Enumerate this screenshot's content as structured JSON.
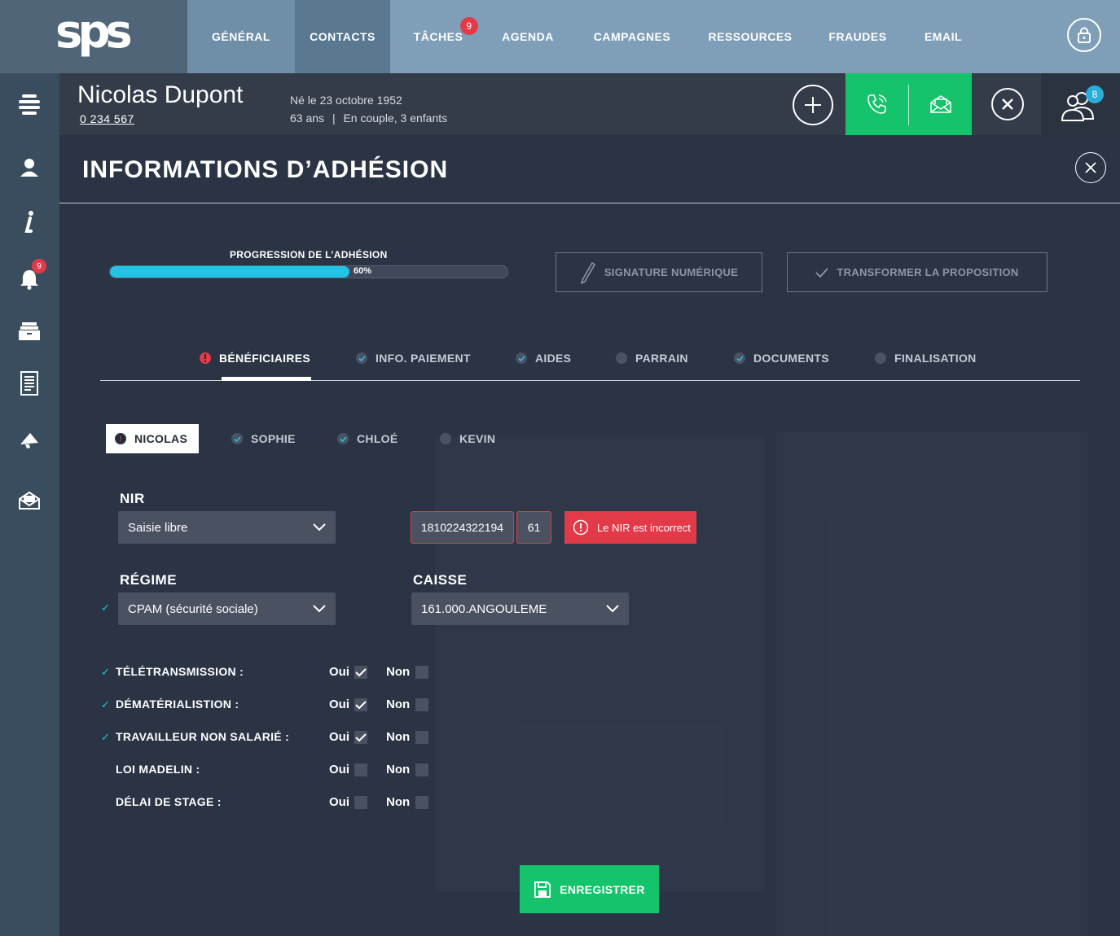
{
  "app": {
    "logo_text": "sps",
    "nav": [
      {
        "label": "GÉNÉRAL"
      },
      {
        "label": "CONTACTS"
      },
      {
        "label": "TÂCHES",
        "badge": "9"
      },
      {
        "label": "AGENDA"
      },
      {
        "label": "CAMPAGNES"
      },
      {
        "label": "RESSOURCES"
      },
      {
        "label": "FRAUDES"
      },
      {
        "label": "EMAIL"
      }
    ],
    "sidebar": {
      "notifications_badge": "9"
    }
  },
  "contact": {
    "name": "Nicolas Dupont",
    "id": "0 234 567",
    "birth": "Né le 23 octobre 1952",
    "age": "63 ans",
    "family": "En couple, 3 enfants",
    "users_badge": "8"
  },
  "modal": {
    "title": "INFORMATIONS D’ADHÉSION",
    "progress": {
      "label": "PROGRESSION DE L’ADHÉSION",
      "percent": 60,
      "percent_text": "60%"
    },
    "actions": {
      "signature": "SIGNATURE NUMÉRIQUE",
      "transform": "TRANSFORMER LA PROPOSITION"
    },
    "tabs": [
      {
        "label": "BÉNÉFICIAIRES",
        "status": "error",
        "active": true
      },
      {
        "label": "INFO. PAIEMENT",
        "status": "check"
      },
      {
        "label": "AIDES",
        "status": "check"
      },
      {
        "label": "PARRAIN",
        "status": "empty"
      },
      {
        "label": "DOCUMENTS",
        "status": "check"
      },
      {
        "label": "FINALISATION",
        "status": "empty"
      }
    ],
    "persons": [
      {
        "label": "NICOLAS",
        "status": "error",
        "active": true
      },
      {
        "label": "SOPHIE",
        "status": "check"
      },
      {
        "label": "CHLOÉ",
        "status": "check"
      },
      {
        "label": "KEVIN",
        "status": "empty"
      }
    ],
    "form": {
      "nir_label": "NIR",
      "nir_mode": "Saisie libre",
      "nir_value": "1810224322194",
      "nir_key": "61",
      "nir_error": "Le NIR est incorrect",
      "regime_label": "RÉGIME",
      "regime_value": "CPAM (sécurité sociale)",
      "caisse_label": "CAISSE",
      "caisse_value": "161.000.ANGOULEME",
      "yes": "Oui",
      "no": "Non",
      "options": [
        {
          "label": "TÉLÉTRANSMISSION :",
          "validated": true,
          "oui": true,
          "non": false
        },
        {
          "label": "DÉMATÉRIALISTION :",
          "validated": true,
          "oui": true,
          "non": false
        },
        {
          "label": "TRAVAILLEUR NON SALARIÉ :",
          "validated": true,
          "oui": true,
          "non": false
        },
        {
          "label": "LOI MADELIN :",
          "validated": false,
          "oui": false,
          "non": false
        },
        {
          "label": "DÉLAI DE STAGE :",
          "validated": false,
          "oui": false,
          "non": false
        }
      ]
    },
    "save_label": "ENREGISTRER"
  },
  "colors": {
    "accent_green": "#14c36b",
    "progress_cyan": "#22c4e6",
    "error_red": "#e23a48"
  }
}
